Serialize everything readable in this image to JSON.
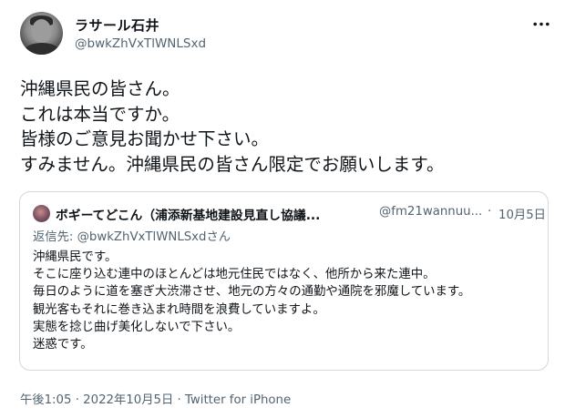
{
  "author": {
    "display_name": "ラサール石井",
    "handle": "@bwkZhVxTlWNLSxd"
  },
  "tweet": {
    "text": "沖縄県民の皆さん。\nこれは本当ですか。\n皆様のご意見お聞かせ下さい。\nすみません。沖縄県民の皆さん限定でお願いします。"
  },
  "quoted_tweet": {
    "display_name": "ボギーてどこん（浦添新基地建設見直し協議...",
    "handle": "@fm21wannuu...",
    "separator": "·",
    "date": "10月5日",
    "reply_prefix": "返信先: ",
    "reply_handle": "@bwkZhVxTlWNLSxdさん",
    "text": "沖縄県民です。\nそこに座り込む連中のほとんどは地元住民ではなく、他所から来た連中。\n毎日のように道を塞ぎ大渋滞させ、地元の方々の通勤や通院を邪魔しています。\n観光客もそれに巻き込まれ時間を浪費していますよ。\n実態を捻じ曲げ美化しないで下さい。\n迷惑です。"
  },
  "meta": {
    "time": "午後1:05",
    "separator1": " · ",
    "date": "2022年10月5日",
    "separator2": " · ",
    "client": "Twitter for iPhone"
  },
  "icons": {
    "more": "more-horizontal-icon"
  }
}
